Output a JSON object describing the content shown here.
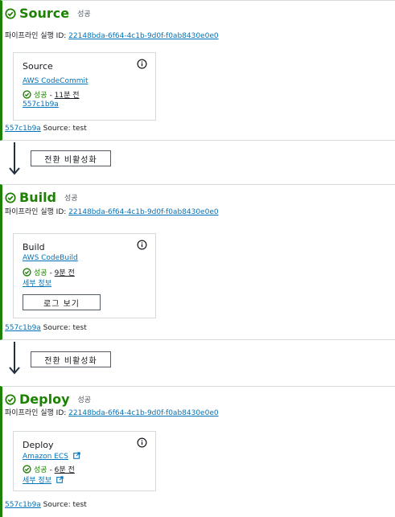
{
  "exec_label": "파이프라인 실행 ID: ",
  "exec_id": "22148bda-6f64-4c1b-9d0f-f0ab8430e0e0",
  "transition_label": "전환 비활성화",
  "stages": [
    {
      "name": "Source",
      "status": "성공",
      "card": {
        "title": "Source",
        "provider": "AWS CodeCommit",
        "status": "성공",
        "sep": " - ",
        "time": "11분 전",
        "link": "557c1b9a"
      },
      "commit_id": "557c1b9a",
      "commit_text": " Source: test"
    },
    {
      "name": "Build",
      "status": "성공",
      "card": {
        "title": "Build",
        "provider": "AWS CodeBuild",
        "status": "성공",
        "sep": " - ",
        "time": "9분 전",
        "link": "세부 정보",
        "button": "로그 보기"
      },
      "commit_id": "557c1b9a",
      "commit_text": " Source: test"
    },
    {
      "name": "Deploy",
      "status": "성공",
      "card": {
        "title": "Deploy",
        "provider": "Amazon ECS",
        "status": "성공",
        "sep": " - ",
        "time": "6분 전",
        "link": "세부 정보"
      },
      "commit_id": "557c1b9a",
      "commit_text": " Source: test"
    }
  ],
  "colors": {
    "success": "#1d8102",
    "link": "#0073bb",
    "border": "#d5dbdb"
  },
  "icons": {
    "status": "check-circle-icon",
    "info": "info-icon",
    "external": "external-link-icon",
    "transition": "arrow-down-icon"
  }
}
